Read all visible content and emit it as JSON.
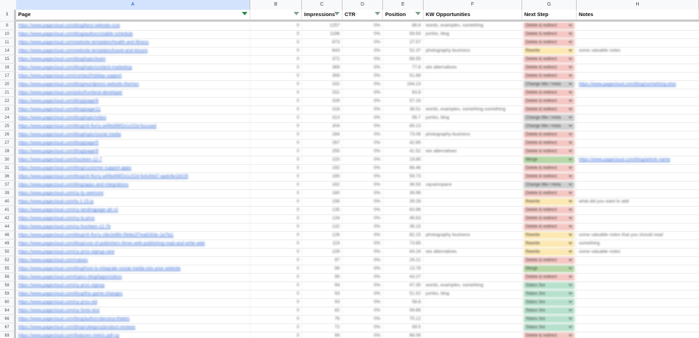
{
  "sheet": {
    "column_letters": [
      "A",
      "B",
      "C",
      "D",
      "E",
      "F",
      "G",
      "H"
    ],
    "headers": {
      "page": "Page",
      "b": "",
      "impressions": "Impressions",
      "ctr": "CTR",
      "position": "Position",
      "kw": "KW Opportunities",
      "next_step": "Next Step",
      "notes": "Notes"
    },
    "header_row_number": "1",
    "step_colors": {
      "Delete & redirect": "#f4c7c3",
      "Rewrite": "#fce8b2",
      "Change title / meta": "#cfcfcf",
      "Merge": "#b7d7a8",
      "Status 3xx": "#b7e1cd"
    },
    "rows": [
      {
        "n": "8",
        "page": "https://www.pagecloud.com/blog/best-website-cost",
        "b": "0",
        "imp": "1257",
        "ctr": "0%",
        "pos": "86.6",
        "kw": "words, examples, something",
        "step": "Delete & redirect",
        "notes": ""
      },
      {
        "n": "10",
        "page": "https://www.pagecloud.com/blog/authors/stable-schedule",
        "b": "0",
        "imp": "1186",
        "ctr": "0%",
        "pos": "58.93",
        "kw": "jumbo, blog",
        "step": "Delete & redirect",
        "notes": ""
      },
      {
        "n": "11",
        "page": "https://www.pagecloud.com/website-templates/health-and-fitness",
        "b": "0",
        "imp": "873",
        "ctr": "0%",
        "pos": "27.57",
        "kw": "",
        "step": "Delete & redirect",
        "notes": ""
      },
      {
        "n": "14",
        "page": "https://www.pagecloud.com/website-templates/travel-and-leisure",
        "b": "0",
        "imp": "643",
        "ctr": "0%",
        "pos": "52.37",
        "kw": "photography business",
        "step": "Rewrite",
        "notes": "some valuable notes"
      },
      {
        "n": "15",
        "page": "https://www.pagecloud.com/blog/topic/team",
        "b": "0",
        "imp": "372",
        "ctr": "0%",
        "pos": "68.55",
        "kw": "",
        "step": "Delete & redirect",
        "notes": ""
      },
      {
        "n": "16",
        "page": "https://www.pagecloud.com/blog/topic/content-marketing",
        "b": "0",
        "imp": "369",
        "ctr": "0%",
        "pos": "77.6",
        "kw": "wix alternatives",
        "step": "Delete & redirect",
        "notes": ""
      },
      {
        "n": "17",
        "page": "https://www.pagecloud.com/contact/holiday-support",
        "b": "0",
        "imp": "359",
        "ctr": "0%",
        "pos": "51.69",
        "kw": "",
        "step": "Delete & redirect",
        "notes": ""
      },
      {
        "n": "20",
        "page": "https://www.pagecloud.com/blog/wordpress-website-themes",
        "b": "0",
        "imp": "332",
        "ctr": "0%",
        "pos": "164.23",
        "kw": "",
        "step": "Change title / meta",
        "notes": "https://www.pagecloud.com/blog/something-else"
      },
      {
        "n": "21",
        "page": "https://www.pagecloud.com/jobs/frontend-developer",
        "b": "0",
        "imp": "331",
        "ctr": "0%",
        "pos": "63.8",
        "kw": "",
        "step": "Delete & redirect",
        "notes": ""
      },
      {
        "n": "22",
        "page": "https://www.pagecloud.com/blog/page/6",
        "b": "0",
        "imp": "328",
        "ctr": "0%",
        "pos": "57.16",
        "kw": "",
        "step": "Delete & redirect",
        "notes": ""
      },
      {
        "n": "23",
        "page": "https://www.pagecloud.com/blog/page/11",
        "b": "0",
        "imp": "318",
        "ctr": "0%",
        "pos": "38.51",
        "kw": "words, examples, something something",
        "step": "Delete & redirect",
        "notes": ""
      },
      {
        "n": "24",
        "page": "https://www.pagecloud.com/blog/topic/video",
        "b": "0",
        "imp": "313",
        "ctr": "0%",
        "pos": "56.7",
        "kw": "jumbo, blog",
        "step": "Change title / meta",
        "notes": ""
      },
      {
        "n": "25",
        "page": "https://www.pagecloud.com/blog/c6-flurry-a49bd98f2e1c02d-focused",
        "b": "0",
        "imp": "304",
        "ctr": "0%",
        "pos": "69.13",
        "kw": "",
        "step": "Change title / meta",
        "notes": ""
      },
      {
        "n": "26",
        "page": "https://www.pagecloud.com/blog/topic/social-media",
        "b": "0",
        "imp": "284",
        "ctr": "0%",
        "pos": "73.06",
        "kw": "photography business",
        "step": "Delete & redirect",
        "notes": ""
      },
      {
        "n": "27",
        "page": "https://www.pagecloud.com/blog/page/5",
        "b": "0",
        "imp": "267",
        "ctr": "0%",
        "pos": "42.85",
        "kw": "",
        "step": "Delete & redirect",
        "notes": ""
      },
      {
        "n": "28",
        "page": "https://www.pagecloud.com/blog/page/9",
        "b": "0",
        "imp": "255",
        "ctr": "0%",
        "pos": "41.52",
        "kw": "wix alternatives",
        "step": "Delete & redirect",
        "notes": ""
      },
      {
        "n": "30",
        "page": "https://www.pagecloud.com/fourteen-12-7",
        "b": "0",
        "imp": "220",
        "ctr": "0%",
        "pos": "19.85",
        "kw": "",
        "step": "Merge",
        "notes": "https://www.pagecloud.com/blog/article-name"
      },
      {
        "n": "31",
        "page": "https://www.pagecloud.com/blog/customer-support-apps",
        "b": "0",
        "imp": "192",
        "ctr": "0%",
        "pos": "66.46",
        "kw": "",
        "step": "Delete & redirect",
        "notes": ""
      },
      {
        "n": "36",
        "page": "https://www.pagecloud.com/blog/c6-flurry-a49bd98f2e1c02d-fe4c94d7-aadc6e1b029",
        "b": "0",
        "imp": "165",
        "ctr": "0%",
        "pos": "59.73",
        "kw": "",
        "step": "Delete & redirect",
        "notes": ""
      },
      {
        "n": "37",
        "page": "https://www.pagecloud.com/blog/apps-and-integrations",
        "b": "0",
        "imp": "162",
        "ctr": "0%",
        "pos": "36.93",
        "kw": "squarespace",
        "step": "Change title / meta",
        "notes": ""
      },
      {
        "n": "39",
        "page": "https://www.pagecloud.com/cy-ty-seemore",
        "b": "0",
        "imp": "160",
        "ctr": "0%",
        "pos": "39.96",
        "kw": "",
        "step": "Delete & redirect",
        "notes": ""
      },
      {
        "n": "40",
        "page": "https://www.pagecloud.com/ty-2-15-js",
        "b": "0",
        "imp": "156",
        "ctr": "0%",
        "pos": "39.28",
        "kw": "",
        "step": "Rewrite",
        "notes": "what did you want to add"
      },
      {
        "n": "41",
        "page": "https://www.pagecloud.com/cy-landingpage-alt-v2",
        "b": "0",
        "imp": "135",
        "ctr": "0%",
        "pos": "63.96",
        "kw": "",
        "step": "Delete & redirect",
        "notes": ""
      },
      {
        "n": "42",
        "page": "https://www.pagecloud.com/cy-ty-pros",
        "b": "0",
        "imp": "134",
        "ctr": "0%",
        "pos": "46.63",
        "kw": "",
        "step": "Delete & redirect",
        "notes": ""
      },
      {
        "n": "44",
        "page": "https://www.pagecloud.com/cy-fourteen-12-7b",
        "b": "0",
        "imp": "132",
        "ctr": "0%",
        "pos": "38.15",
        "kw": "",
        "step": "Delete & redirect",
        "notes": ""
      },
      {
        "n": "46",
        "page": "https://www.pagecloud.com/blog/c6-flurry-c8e2e8fd-0fe6e2f7ea8263e-2a7fa1",
        "b": "0",
        "imp": "126",
        "ctr": "0%",
        "pos": "82.15",
        "kw": "photography business",
        "step": "Rewrite",
        "notes": "some valuable notes that you should read"
      },
      {
        "n": "49",
        "page": "https://www.pagecloud.com/blog/cost-of-publishers-three-web-publishing-read-and-write-web",
        "b": "0",
        "imp": "119",
        "ctr": "0%",
        "pos": "73.85",
        "kw": "",
        "step": "Rewrite",
        "notes": "something"
      },
      {
        "n": "50",
        "page": "https://www.pagecloud.com/cy-pros-signup-new",
        "b": "0",
        "imp": "109",
        "ctr": "0%",
        "pos": "64.24",
        "kw": "wix alternatives",
        "step": "Rewrite",
        "notes": "some valuable notes"
      },
      {
        "n": "52",
        "page": "https://www.pagecloud.com/values",
        "b": "0",
        "imp": "97",
        "ctr": "0%",
        "pos": "29.21",
        "kw": "",
        "step": "Delete & redirect",
        "notes": ""
      },
      {
        "n": "55",
        "page": "https://www.pagecloud.com/blog/how-to-integrate-social-media-into-your-website",
        "b": "0",
        "imp": "96",
        "ctr": "0%",
        "pos": "13.76",
        "kw": "",
        "step": "Merge",
        "notes": ""
      },
      {
        "n": "56",
        "page": "https://www.pagecloud.com/topics-blog/tags/visitors",
        "b": "0",
        "imp": "95",
        "ctr": "0%",
        "pos": "43.27",
        "kw": "",
        "step": "Delete & redirect",
        "notes": ""
      },
      {
        "n": "58",
        "page": "https://www.pagecloud.com/cy-pros-signup",
        "b": "0",
        "imp": "94",
        "ctr": "0%",
        "pos": "47.35",
        "kw": "words, examples, something",
        "step": "Status 3xx",
        "notes": ""
      },
      {
        "n": "59",
        "page": "https://www.pagecloud.com/blog/the-game-changes",
        "b": "0",
        "imp": "93",
        "ctr": "0%",
        "pos": "51.52",
        "kw": "jumbo, blog",
        "step": "Status 3xx",
        "notes": ""
      },
      {
        "n": "60",
        "page": "https://www.pagecloud.com/cy-pros-old",
        "b": "0",
        "imp": "93",
        "ctr": "0%",
        "pos": "58.8",
        "kw": "",
        "step": "Status 3xx",
        "notes": ""
      },
      {
        "n": "64",
        "page": "https://www.pagecloud.com/cy-fonts-test",
        "b": "0",
        "imp": "82",
        "ctr": "0%",
        "pos": "56.66",
        "kw": "",
        "step": "Status 3xx",
        "notes": ""
      },
      {
        "n": "66",
        "page": "https://www.pagecloud.com/blog/authors/jessica-thiebis",
        "b": "0",
        "imp": "76",
        "ctr": "0%",
        "pos": "75.12",
        "kw": "",
        "step": "Status 3xx",
        "notes": ""
      },
      {
        "n": "67",
        "page": "https://www.pagecloud.com/blog/category/product-reviews",
        "b": "0",
        "imp": "72",
        "ctr": "0%",
        "pos": "59.5",
        "kw": "",
        "step": "Status 3xx",
        "notes": ""
      },
      {
        "n": "69",
        "page": "https://www.pagecloud.com/features-metric-pdf-cg",
        "b": "0",
        "imp": "69",
        "ctr": "0%",
        "pos": "66.06",
        "kw": "",
        "step": "Delete & redirect",
        "notes": ""
      }
    ]
  }
}
